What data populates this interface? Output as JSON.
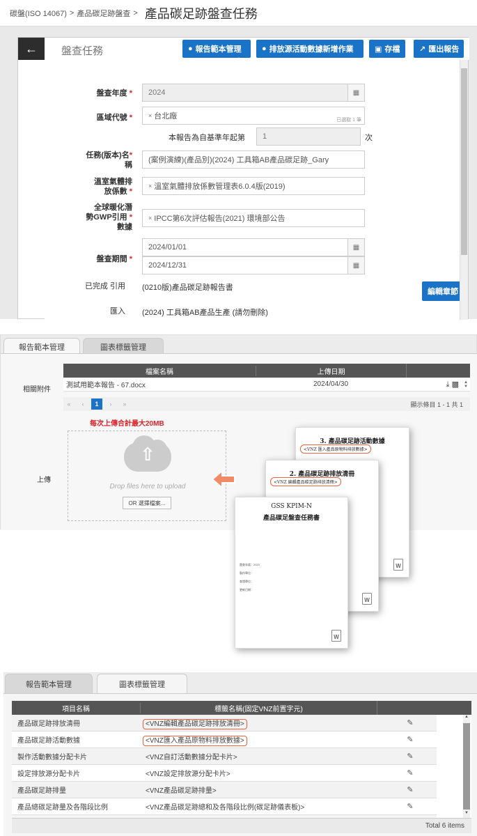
{
  "breadcrumb": {
    "items": [
      "碳盤(ISO 14067)",
      "產品碳足跡盤查"
    ],
    "separator": ">",
    "title": "產品碳足跡盤查任務"
  },
  "card": {
    "title": "盤查任務",
    "buttons": {
      "template": "報告範本管理",
      "add_activity": "排放源活動數據新增作業",
      "save": "存檔",
      "export": "匯出報告",
      "edit_chapter": "編輯章節"
    }
  },
  "form": {
    "year_label": "盤查年度",
    "year_value": "2024",
    "region_label": "區域代號",
    "region_value": "台北廠",
    "region_selected": "已選取 1 筆",
    "report_count_prefix": "本報告為自基準年起第",
    "report_count_value": "1",
    "report_count_suffix": "次",
    "task_label_1": "任務(版本)名",
    "task_label_2": "稱",
    "task_value": "(案例演練)(產品別)(2024) 工具箱AB產品碳足跡_Gary",
    "ghg_label_1": "溫室氣體排",
    "ghg_label_2": "放係數",
    "ghg_value": "溫室氣體排放係數管理表6.0.4版(2019)",
    "gwp_label_1": "全球暖化潛",
    "gwp_label_2": "勢GWP引用",
    "gwp_label_3": "數據",
    "gwp_value": "IPCC第6次評估報告(2021) 環境部公告",
    "period_label": "盤查期間",
    "period_start": "2024/01/01",
    "period_end": "2024/12/31",
    "completed_label": "已完成 引用",
    "completed_value": "(0210版)產品碳足跡報告書",
    "import_label": "匯入",
    "import_value": "(2024) 工具箱AB產品生產 (請勿刪除)",
    "required_mark": "*"
  },
  "section2": {
    "tabs": [
      "報告範本管理",
      "圖表標籤管理"
    ],
    "attachment_label": "相關附件",
    "columns": [
      "檔案名稱",
      "上傳日期"
    ],
    "rows": [
      {
        "name": "測試用範本報告 - 67.docx",
        "date": "2024/04/30"
      }
    ],
    "pager_current": "1",
    "pager_info": "顯示條目 1 - 1 共 1",
    "upload_limit": "每次上傳合計最大20MB",
    "upload_label": "上傳",
    "drop_text": "Drop files here to upload",
    "choose_button": "OR 選擇檔案..."
  },
  "documents": {
    "doc3_title": "3. 產品碳足跡活動數據",
    "doc3_tag": "<VNZ 匯入產品原物料排放數據>",
    "doc2_title": "2. 產品碳足跡排放清冊",
    "doc2_tag": "<VNZ 編輯產品碳足跡排放清冊>",
    "doc1_title_1": "GSS KPIM-N",
    "doc1_title_2": "產品碳足盤查任務書",
    "doc1_lines": [
      "盤查年度：2023",
      "製作單位：",
      "查證單位：",
      "更新日期："
    ],
    "word_icon": "W"
  },
  "section3": {
    "tabs": [
      "報告範本管理",
      "圖表標籤管理"
    ],
    "columns": [
      "項目名稱",
      "標籤名稱(固定VNZ前置字元)"
    ],
    "rows": [
      {
        "name": "產品碳足跡排放清冊",
        "tag": "<VNZ編輯產品碳足跡排放清冊>",
        "highlight": true
      },
      {
        "name": "產品碳足跡活動數據",
        "tag": "<VNZ匯入產品原物料排放數據>",
        "highlight": true
      },
      {
        "name": "製作活動數據分配卡片",
        "tag": "<VNZ自訂活動數據分配卡片>",
        "highlight": false
      },
      {
        "name": "設定排放源分配卡片",
        "tag": "<VNZ設定排放源分配卡片>",
        "highlight": false
      },
      {
        "name": "產品碳足跡排量",
        "tag": "<VNZ產品碳足跡排量>",
        "highlight": false
      },
      {
        "name": "產品總碳足跡量及各階段比例",
        "tag": "<VNZ產品碳足跡總和及各階段比例(碳足跡儀表板)>",
        "highlight": false
      }
    ],
    "total": "Total 6 items"
  },
  "colors": {
    "accent": "#1a73c7",
    "highlight": "#e8643c",
    "required": "#d9232a",
    "header_dark": "#555555"
  }
}
